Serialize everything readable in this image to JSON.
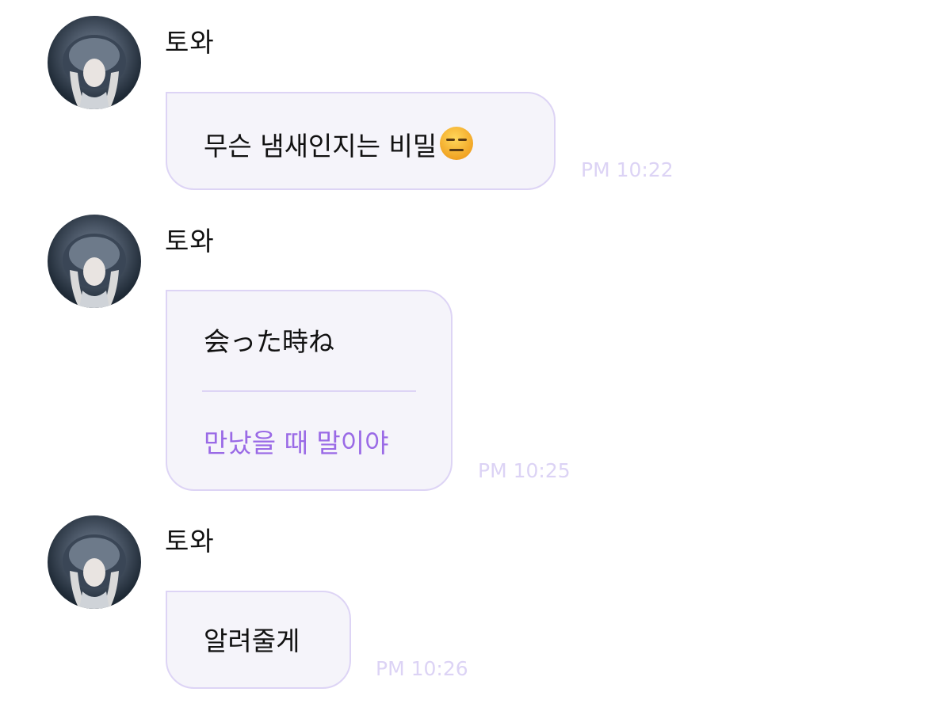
{
  "messages": [
    {
      "sender": "토와",
      "text": "무슨 냄새인지는 비밀",
      "emoji": "expressionless-face-icon",
      "time": "PM 10:22"
    },
    {
      "sender": "토와",
      "text": "会った時ね",
      "translation": "만났을 때 말이야",
      "time": "PM 10:25"
    },
    {
      "sender": "토와",
      "text": "알려줄게",
      "time": "PM 10:26"
    }
  ],
  "colors": {
    "bubble_bg": "#f5f4fa",
    "bubble_border": "#ddd4f5",
    "translation_text": "#9a6ae6",
    "timestamp": "#dcd3f5"
  }
}
